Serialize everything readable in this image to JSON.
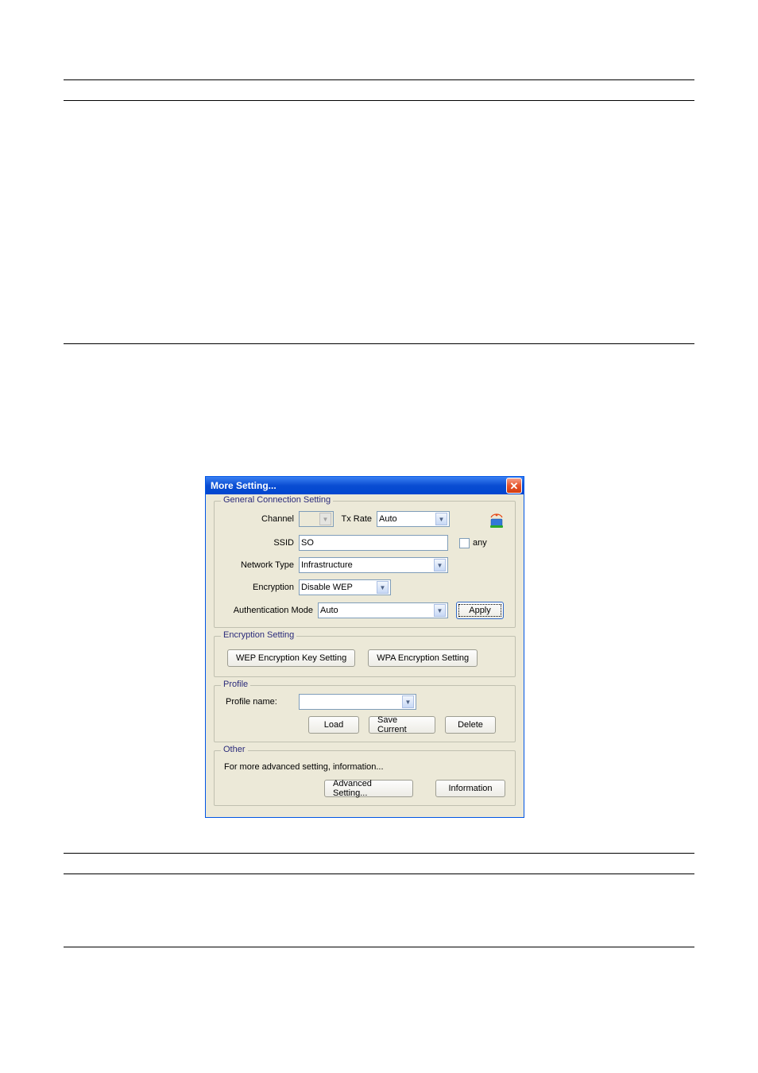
{
  "dialog": {
    "title": "More Setting...",
    "close_x": "✕"
  },
  "general": {
    "legend": "General Connection Setting",
    "channel_label": "Channel",
    "channel_value": "",
    "txrate_label": "Tx Rate",
    "txrate_value": "Auto",
    "ssid_label": "SSID",
    "ssid_value": "SO",
    "any_label": "any",
    "network_type_label": "Network Type",
    "network_type_value": "Infrastructure",
    "encryption_label": "Encryption",
    "encryption_value": "Disable WEP",
    "auth_mode_label": "Authentication Mode",
    "auth_mode_value": "Auto",
    "apply_label": "Apply"
  },
  "encryption": {
    "legend": "Encryption Setting",
    "wep_btn": "WEP Encryption Key Setting",
    "wpa_btn": "WPA Encryption Setting"
  },
  "profile": {
    "legend": "Profile",
    "name_label": "Profile name:",
    "name_value": "",
    "load_btn": "Load",
    "save_btn": "Save Current",
    "delete_btn": "Delete"
  },
  "other": {
    "legend": "Other",
    "desc": "For more advanced setting, information...",
    "advanced_btn": "Advanced Setting...",
    "info_btn": "Information"
  }
}
